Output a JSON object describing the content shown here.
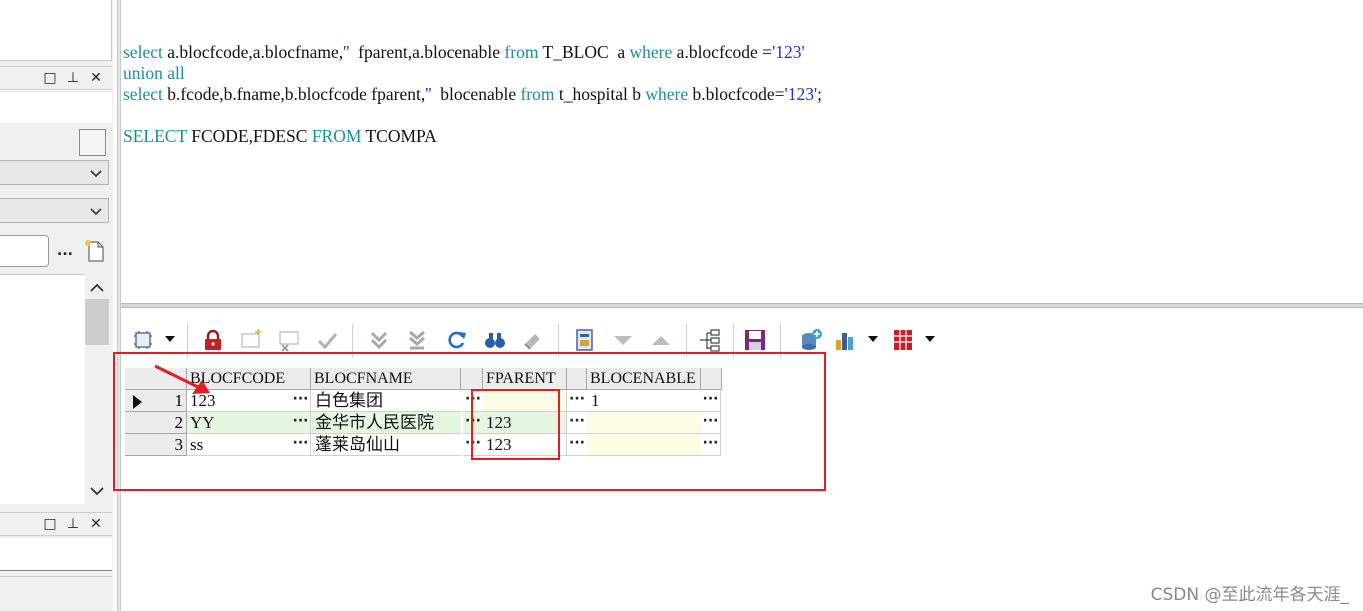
{
  "sql_editor": {
    "line1": {
      "t1": "select",
      "t2": " a.blocfcode,a.blocfname,",
      "t3": "''",
      "t4": "  fparent,a.blocenable ",
      "t5": "from",
      "t6": " T_BLOC  a ",
      "t7": "where",
      "t8": " a.blocfcode =",
      "t9": "'123'"
    },
    "line2": "union all",
    "line3": {
      "t1": "select",
      "t2": " b.fcode,b.fname,b.blocfcode fparent,",
      "t3": "''",
      "t4": "  blocenable ",
      "t5": "from",
      "t6": " t_hospital b ",
      "t7": "where",
      "t8": " b.blocfcode=",
      "t9": "'123'",
      "t10": ";"
    },
    "line5": {
      "t1": "SELECT",
      "t2": " FCODE,FDESC ",
      "t3": "FROM",
      "t4": " TCOMPA"
    }
  },
  "left_panel": {
    "titlebar_buttons": [
      "□",
      "⊥",
      "✕"
    ],
    "lower_titlebar_buttons": [
      "□",
      "⊥",
      "✕"
    ],
    "browse_label": "..."
  },
  "toolbar_icons": [
    "grid-options-icon",
    "lock-icon",
    "insert-record-icon",
    "delete-record-icon",
    "post-record-icon",
    "first-record-icon",
    "last-record-icon",
    "refresh-icon",
    "find-icon",
    "clear-icon",
    "query-by-example-icon",
    "filter-down-icon",
    "filter-up-icon",
    "tree-view-icon",
    "save-icon",
    "export-icon",
    "chart-icon",
    "table-icon"
  ],
  "grid": {
    "columns": [
      "BLOCFCODE",
      "BLOCFNAME",
      "FPARENT",
      "BLOCENABLE"
    ],
    "rows": [
      {
        "num": "1",
        "cells": [
          "123",
          "白色集团",
          "",
          "1"
        ],
        "current": true
      },
      {
        "num": "2",
        "cells": [
          "YY",
          "金华市人民医院",
          "123",
          ""
        ]
      },
      {
        "num": "3",
        "cells": [
          "ss",
          "蓬莱岛仙山",
          "123",
          ""
        ]
      }
    ],
    "ellipsis": "···"
  },
  "colors": {
    "keyword": "#1a8da0",
    "string": "#2a33c4",
    "highlight_red": "#e01e24",
    "row_green": "#e6f7e1",
    "cell_yellow": "#fdfde6"
  },
  "watermark": "CSDN @至此流年各天涯_"
}
